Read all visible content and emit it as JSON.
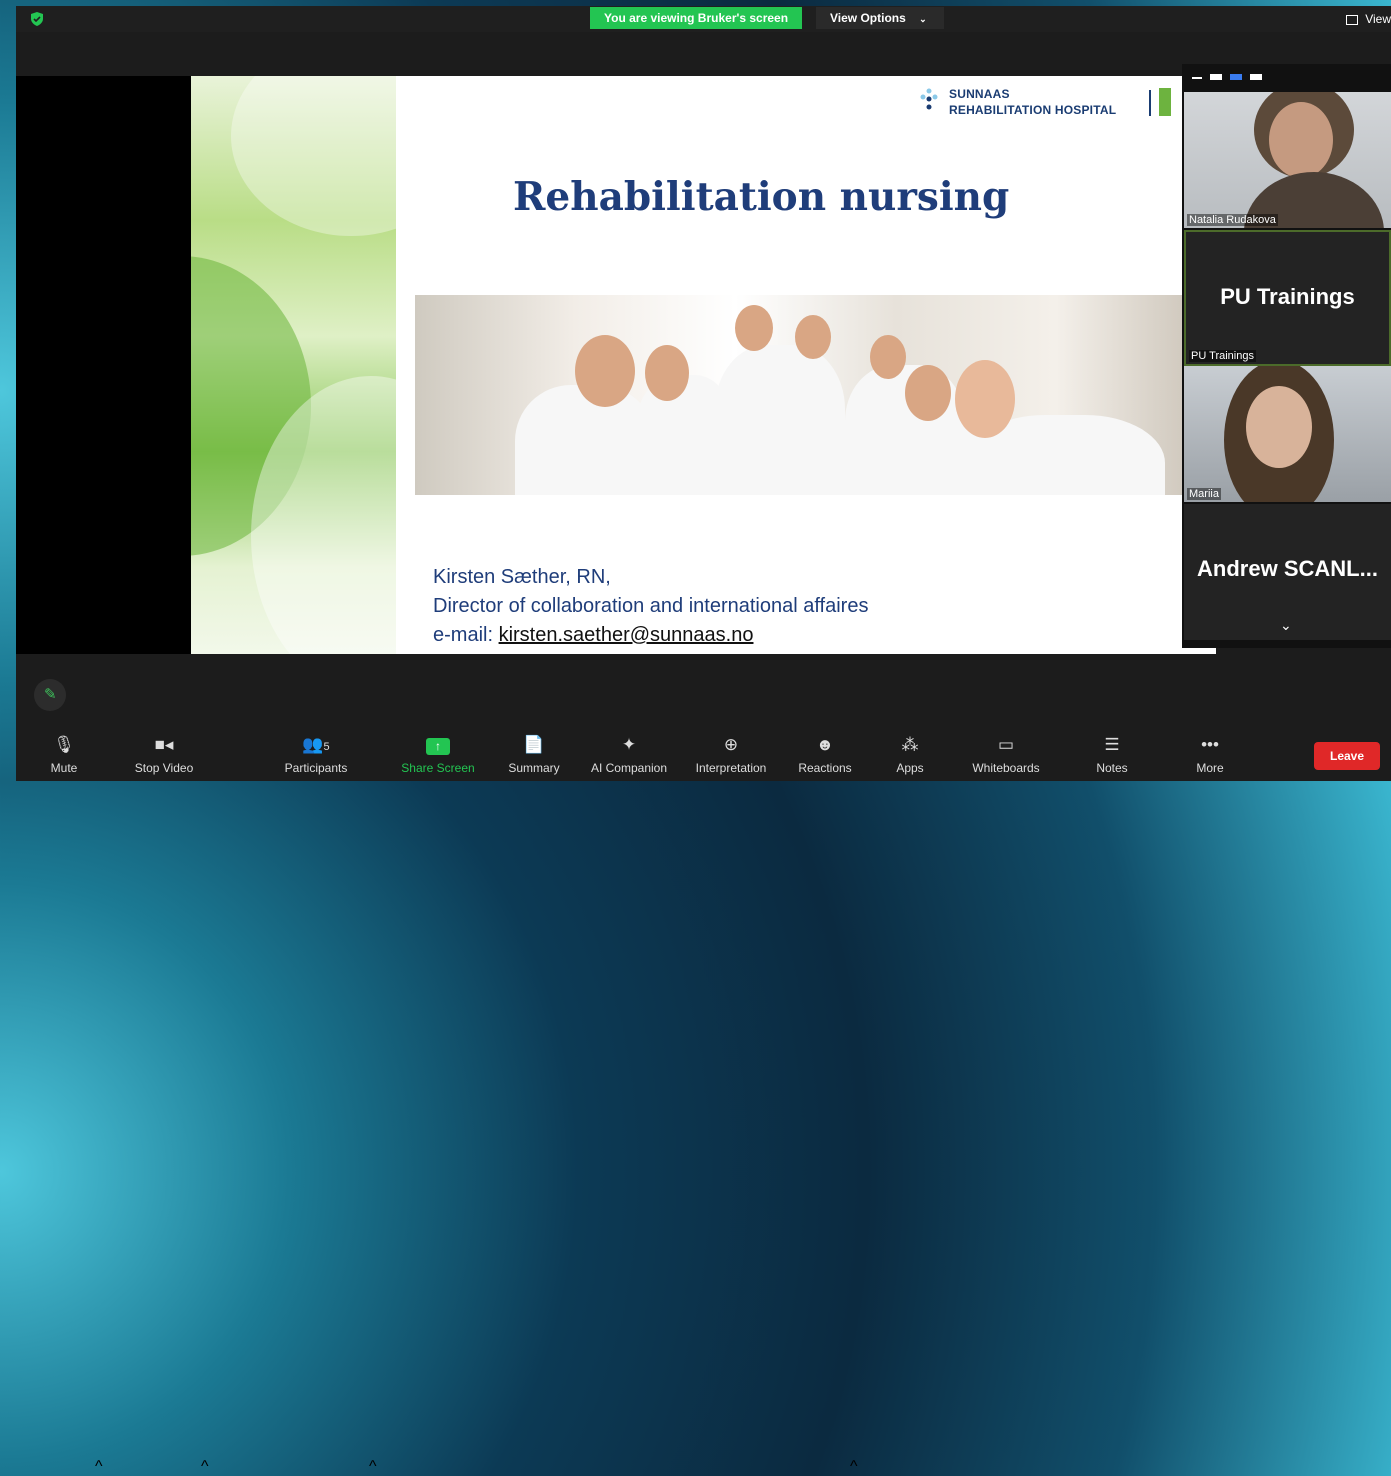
{
  "banner": {
    "viewing": "You are viewing Bruker's screen",
    "view_options": "View Options",
    "caret": "⌄",
    "view": "View"
  },
  "slide": {
    "logo_line1": "SUNNAAS",
    "logo_line2": "REHABILITATION HOSPITAL",
    "title": "Rehabilitation nursing",
    "author_name": "Kirsten Sæther, RN,",
    "author_role": "Director of collaboration and international affaires",
    "email_label": "e-mail: ",
    "email": "kirsten.saether@sunnaas.no"
  },
  "gallery": {
    "participants": [
      {
        "name": "Natalia Rudakova",
        "display": ""
      },
      {
        "name": "PU Trainings",
        "display": "PU Trainings"
      },
      {
        "name": "Mariia",
        "display": ""
      },
      {
        "name": "",
        "display": "Andrew  SCANL..."
      }
    ]
  },
  "toolbar": {
    "mute": "Mute",
    "stop_video": "Stop Video",
    "participants": "Participants",
    "participants_count": "5",
    "share_screen": "Share Screen",
    "summary": "Summary",
    "ai_companion": "AI Companion",
    "interpretation": "Interpretation",
    "reactions": "Reactions",
    "apps": "Apps",
    "whiteboards": "Whiteboards",
    "notes": "Notes",
    "more": "More",
    "leave": "Leave"
  },
  "colors": {
    "share_green": "#23c552",
    "leave_red": "#e02828",
    "slide_blue": "#1f3d7a"
  }
}
